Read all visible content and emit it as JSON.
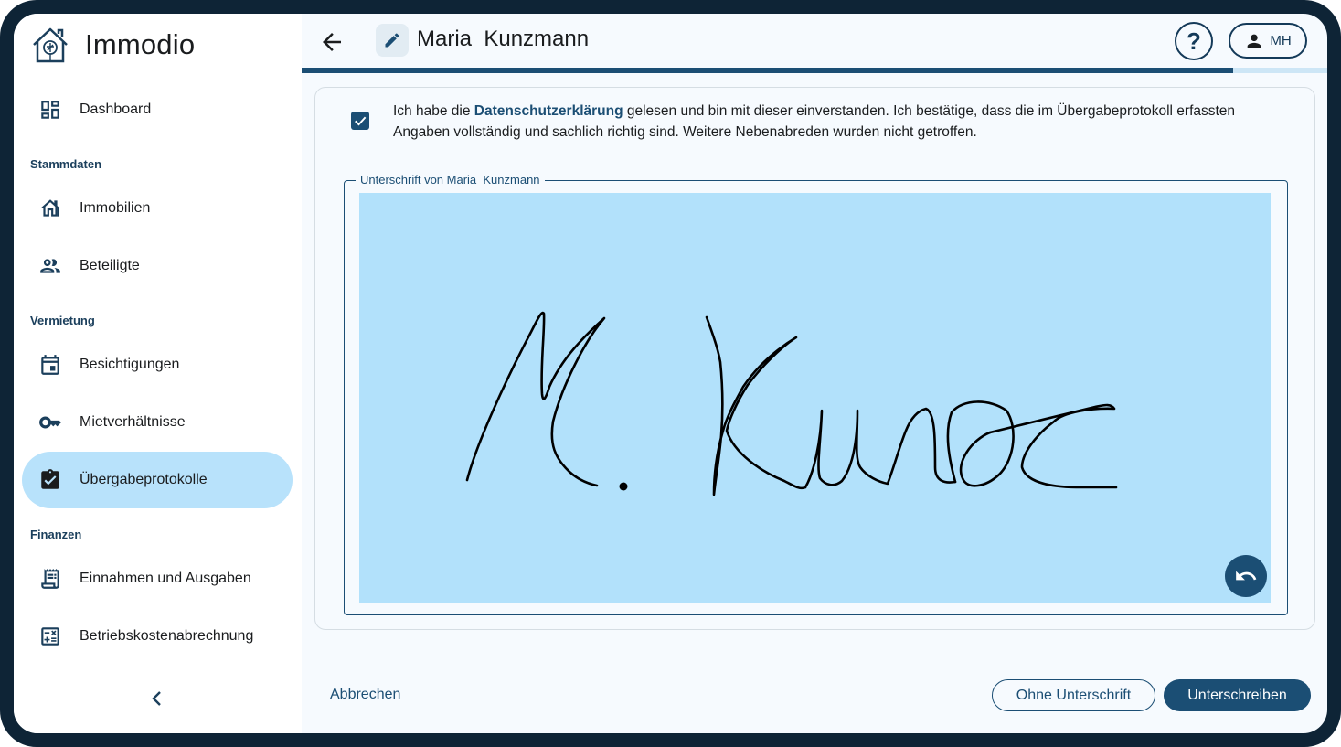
{
  "app": {
    "name": "Immodio"
  },
  "sidebar": {
    "items": [
      {
        "label": "Dashboard",
        "icon": "dashboard-icon"
      },
      {
        "section": "Stammdaten"
      },
      {
        "label": "Immobilien",
        "icon": "building-icon"
      },
      {
        "label": "Beteiligte",
        "icon": "people-icon"
      },
      {
        "section": "Vermietung"
      },
      {
        "label": "Besichtigungen",
        "icon": "calendar-icon"
      },
      {
        "label": "Mietverhältnisse",
        "icon": "key-icon"
      },
      {
        "label": "Übergabeprotokolle",
        "icon": "clipboard-check-icon",
        "active": true
      },
      {
        "section": "Finanzen"
      },
      {
        "label": "Einnahmen und Ausgaben",
        "icon": "receipt-icon"
      },
      {
        "label": "Betriebskostenabrechnung",
        "icon": "calculator-icon"
      }
    ]
  },
  "header": {
    "title": "Maria  Kunzmann",
    "help_label": "?",
    "user_initials": "MH",
    "progress_percent": 90.8
  },
  "consent": {
    "checked": true,
    "text_before": "Ich habe die ",
    "link_text": "Datenschutzerklärung",
    "text_after": " gelesen und bin mit dieser einverstanden. Ich bestätige, dass die im Übergabeprotokoll erfassten Angaben vollständig und sachlich richtig sind. Weitere Nebenabreden wurden nicht getroffen."
  },
  "signature": {
    "label": "Unterschrift von Maria  Kunzmann"
  },
  "footer": {
    "cancel_label": "Abbrechen",
    "skip_label": "Ohne Unterschrift",
    "sign_label": "Unterschreiben"
  },
  "colors": {
    "primary": "#1b4e74",
    "active_nav": "#b8e2fb",
    "canvas": "#b2e1fb",
    "frame": "#0e2436"
  }
}
